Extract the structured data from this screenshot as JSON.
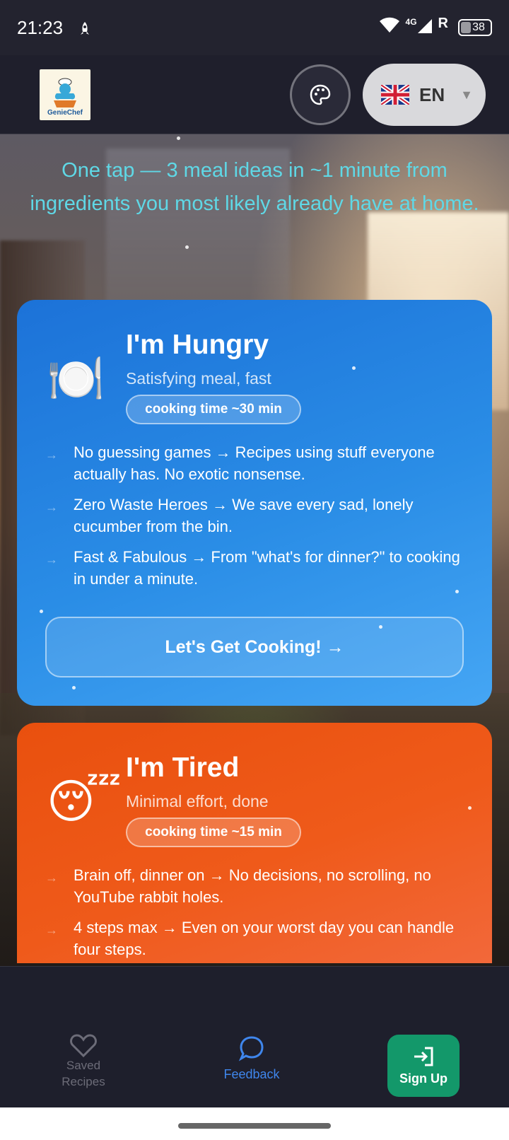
{
  "status_bar": {
    "time": "21:23",
    "network": "4G",
    "roaming": "R",
    "battery": "38"
  },
  "header": {
    "logo_text": "GenieChef",
    "language_code": "EN",
    "language_flag": "uk-flag-icon"
  },
  "tagline": "One tap — 3 meal ideas in ~1 minute from ingredients you most likely already have at home.",
  "cards": [
    {
      "icon": "plate-cutlery-icon",
      "emoji": "🍽️",
      "title": "I'm Hungry",
      "subtitle": "Satisfying meal, fast",
      "badge": "cooking time ~30 min",
      "features": [
        "No guessing games → Recipes using stuff everyone actually has. No exotic nonsense.",
        "Zero Waste Heroes → We save every sad, lonely cucumber from the bin.",
        "Fast & Fabulous → From \"what's for dinner?\" to cooking in under a minute."
      ],
      "cta": "Let's Get Cooking! →",
      "color": "#1c72d8"
    },
    {
      "icon": "sleepy-face-icon",
      "emoji": "😴",
      "title": "I'm Tired",
      "subtitle": "Minimal effort, done",
      "badge": "cooking time ~15 min",
      "features": [
        "Brain off, dinner on → No decisions, no scrolling, no YouTube rabbit holes.",
        "4 steps max → Even on your worst day you can handle four steps."
      ],
      "color": "#e9500e"
    }
  ],
  "bottom_nav": {
    "saved": "Saved Recipes",
    "feedback": "Feedback",
    "signup": "Sign Up"
  },
  "colors": {
    "tagline": "#5fd8e6",
    "feedback_active": "#3f86ec",
    "signup_bg": "#13986a"
  }
}
